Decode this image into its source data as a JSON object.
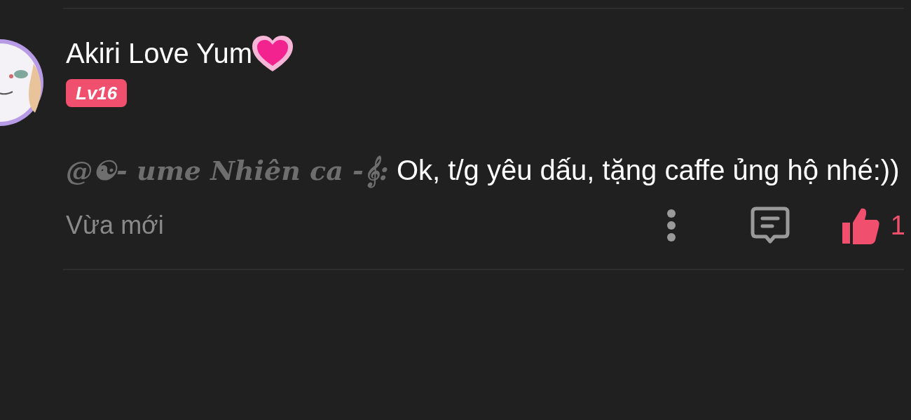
{
  "comment": {
    "author": "Akiri Love Yum",
    "level_badge": "Lv16",
    "mention": "@☯- ume Nhiên ca -𝄞:",
    "text": " Ok, t/g yêu dấu, tặng caffe ủng hộ nhé:))",
    "time": "Vừa mới",
    "liked": true,
    "like_count": "1"
  }
}
